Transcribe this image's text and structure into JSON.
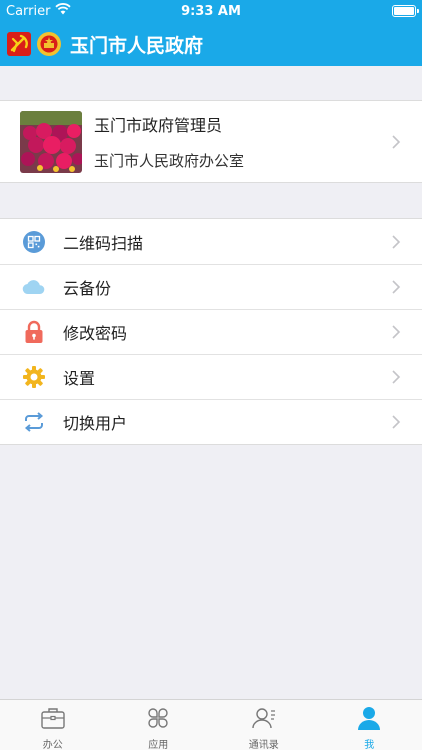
{
  "status_bar": {
    "carrier": "Carrier",
    "time": "9:33 AM"
  },
  "header": {
    "title": "玉门市人民政府"
  },
  "profile": {
    "name": "玉门市政府管理员",
    "organization": "玉门市人民政府办公室"
  },
  "menu": {
    "items": [
      {
        "label": "二维码扫描",
        "icon": "qr-code-icon"
      },
      {
        "label": "云备份",
        "icon": "cloud-icon"
      },
      {
        "label": "修改密码",
        "icon": "lock-icon"
      },
      {
        "label": "设置",
        "icon": "gear-icon"
      },
      {
        "label": "切换用户",
        "icon": "switch-user-icon"
      }
    ]
  },
  "tabbar": {
    "tabs": [
      {
        "label": "办公",
        "icon": "briefcase-icon"
      },
      {
        "label": "应用",
        "icon": "apps-icon"
      },
      {
        "label": "通讯录",
        "icon": "contacts-icon"
      },
      {
        "label": "我",
        "icon": "person-icon"
      }
    ],
    "active": "我"
  },
  "colors": {
    "accent": "#1aa9e8",
    "background": "#efeff4",
    "lock": "#f06a5c",
    "gear": "#f2b51e",
    "cloud": "#9fd4f2"
  }
}
